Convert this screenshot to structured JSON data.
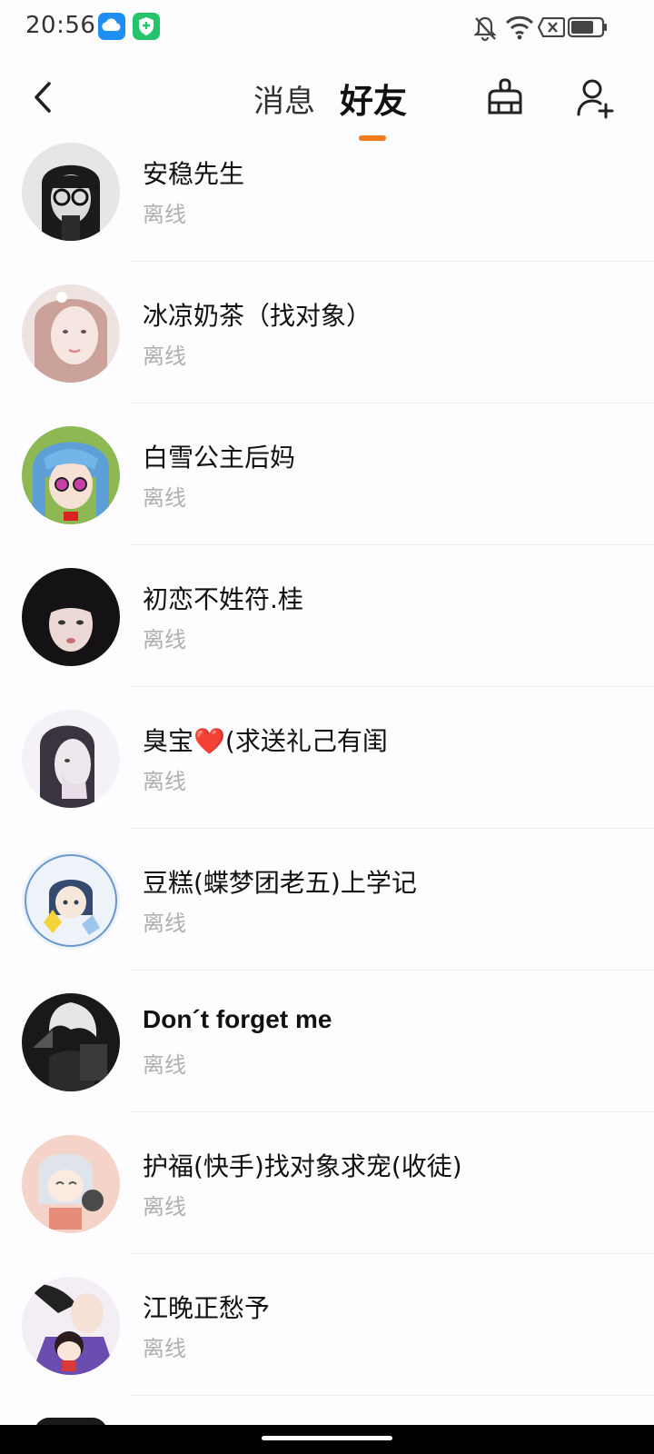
{
  "status_bar": {
    "time": "20:56",
    "app_icons": [
      "weather-cloud-icon",
      "shield-app-icon"
    ],
    "system_icons": [
      "bell-muted-icon",
      "wifi-icon",
      "no-sim-icon",
      "battery-icon"
    ]
  },
  "header": {
    "tabs": [
      {
        "label": "消息",
        "active": false
      },
      {
        "label": "好友",
        "active": true
      }
    ],
    "accent_color": "#f07a1c"
  },
  "friends": [
    {
      "name": "安稳先生",
      "status": "离线"
    },
    {
      "name": "冰凉奶茶（找对象）",
      "status": "离线"
    },
    {
      "name": "白雪公主后妈",
      "status": "离线"
    },
    {
      "name": "初恋不姓符.桂",
      "status": "离线"
    },
    {
      "name": "臭宝",
      "emoji": "❤️",
      "name_suffix": "(求送礼己有闺",
      "status": "离线"
    },
    {
      "name": "豆糕(蝶梦团老五)上学记",
      "status": "离线"
    },
    {
      "name": "Don´t forget me",
      "status": "离线"
    },
    {
      "name": "护福(快手)找对象求宠(收徒)",
      "status": "离线"
    },
    {
      "name": "江晚正愁予",
      "status": "离线"
    }
  ]
}
